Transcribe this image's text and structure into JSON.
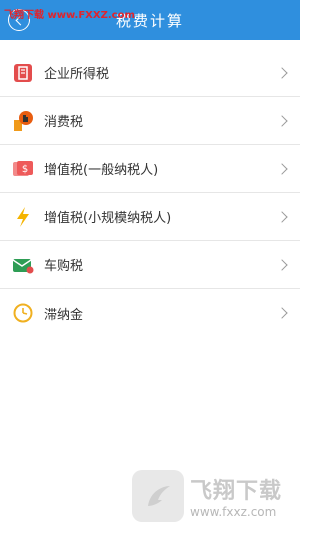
{
  "header": {
    "title": "税费计算",
    "back_icon": "back-circle-icon"
  },
  "watermark_top": "飞翔下载 www.FXXZ.com",
  "items": [
    {
      "label": "企业所得税",
      "icon": "building-tax-icon",
      "color": "#e34d4d"
    },
    {
      "label": "消费税",
      "icon": "consumption-tax-icon",
      "color": "#f09a1a"
    },
    {
      "label": "增值税(一般纳税人)",
      "icon": "dollar-card-icon",
      "color": "#f06a6a"
    },
    {
      "label": "增值税(小规模纳税人)",
      "icon": "lightning-icon",
      "color": "#f5b400"
    },
    {
      "label": "车购税",
      "icon": "envelope-car-icon",
      "color": "#2e9d55"
    },
    {
      "label": "滞纳金",
      "icon": "clock-icon",
      "color": "#f0b020"
    }
  ],
  "watermark_logo": {
    "cn": "飞翔下载",
    "en": "www.fxxz.com"
  },
  "colors": {
    "header": "#2f8fde"
  }
}
